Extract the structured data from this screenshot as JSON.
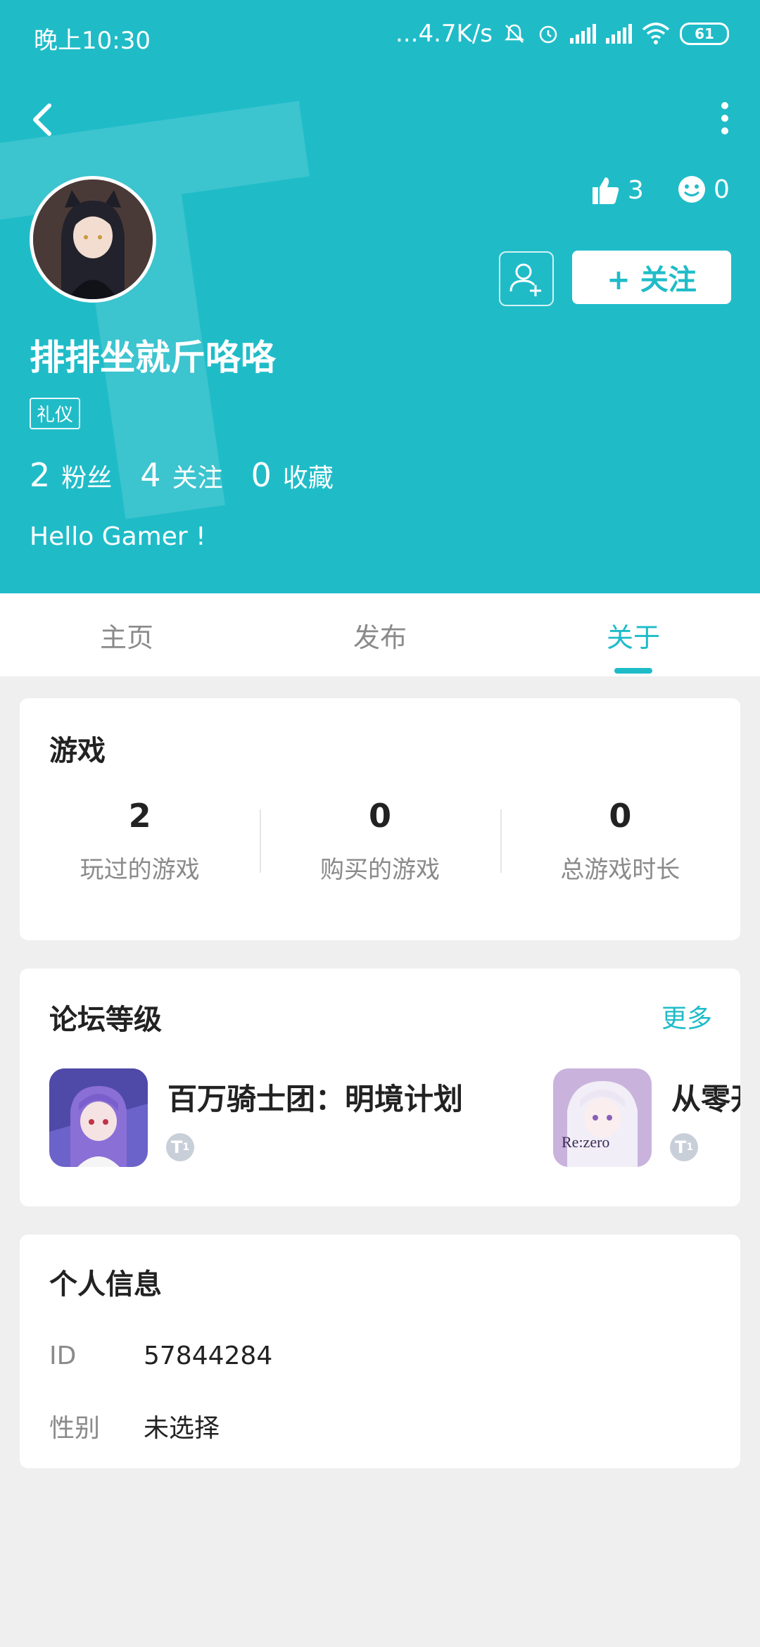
{
  "status": {
    "time": "晚上10:30",
    "net_speed": "...4.7K/s",
    "battery": "61"
  },
  "profile": {
    "likes": "3",
    "smiles": "0",
    "follow_label": "+ 关注",
    "name": "排排坐就斤咯咯",
    "tag": "礼仪",
    "counts": [
      {
        "num": "2",
        "label": "粉丝"
      },
      {
        "num": "4",
        "label": "关注"
      },
      {
        "num": "0",
        "label": "收藏"
      }
    ],
    "bio": "Hello Gamer !"
  },
  "tabs": [
    {
      "label": "主页"
    },
    {
      "label": "发布"
    },
    {
      "label": "关于"
    }
  ],
  "games_card": {
    "title": "游戏",
    "stats": [
      {
        "num": "2",
        "label": "玩过的游戏"
      },
      {
        "num": "0",
        "label": "购买的游戏"
      },
      {
        "num": "0",
        "label": "总游戏时长"
      }
    ]
  },
  "forum_card": {
    "title": "论坛等级",
    "more": "更多",
    "games": [
      {
        "name": "百万骑士团：明境计划",
        "level": "1"
      },
      {
        "name": "从零开",
        "level": "1",
        "icon_text": "Re:zero"
      }
    ]
  },
  "info_card": {
    "title": "个人信息",
    "rows": [
      {
        "key": "ID",
        "value": "57844284"
      },
      {
        "key": "性别",
        "value": "未选择"
      }
    ]
  },
  "colors": {
    "accent": "#1fbcc8"
  }
}
